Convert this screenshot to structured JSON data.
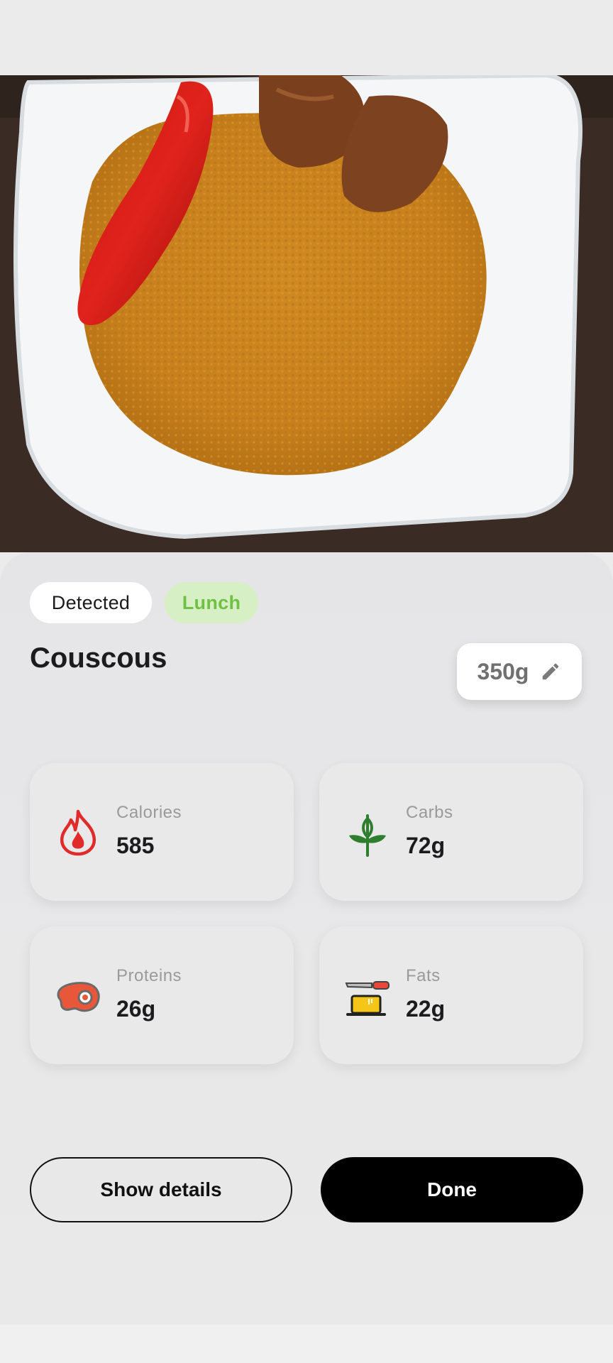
{
  "photo": {
    "alt": "Couscous"
  },
  "tags": {
    "detected": "Detected",
    "meal": "Lunch"
  },
  "food": {
    "name": "Couscous",
    "weight": "350g"
  },
  "stats": [
    {
      "label": "Calories",
      "value": "585",
      "icon": "flame-icon",
      "color": "#e12b2b"
    },
    {
      "label": "Carbs",
      "value": "72g",
      "icon": "wheat-icon",
      "color": "#2f7d2f"
    },
    {
      "label": "Proteins",
      "value": "26g",
      "icon": "steak-icon",
      "color": "#e85c3c"
    },
    {
      "label": "Fats",
      "value": "22g",
      "icon": "butter-icon",
      "color": "#f5c518"
    }
  ],
  "actions": {
    "details": "Show details",
    "done": "Done"
  },
  "colors": {
    "accent_green": "#6fc043",
    "primary_button": "#000000"
  }
}
